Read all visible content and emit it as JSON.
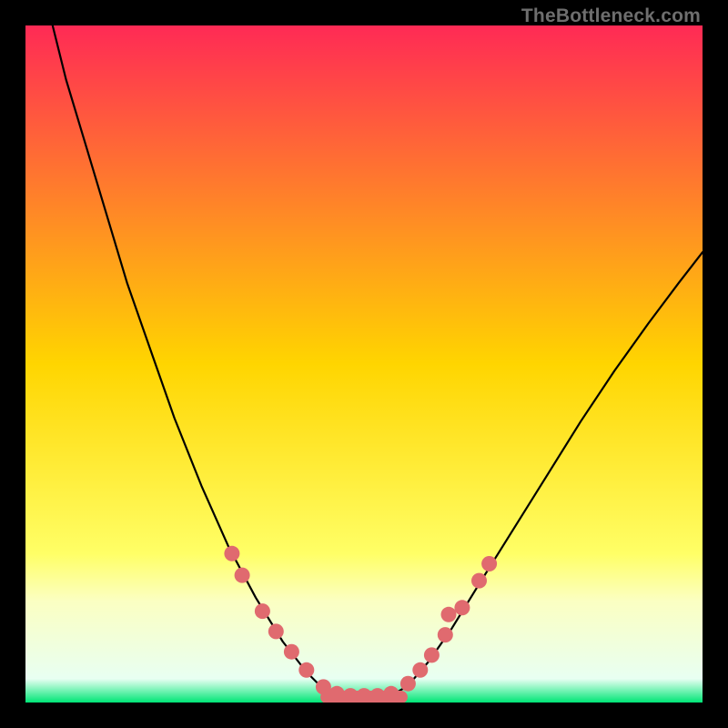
{
  "watermark": "TheBottleneck.com",
  "chart_data": {
    "type": "line",
    "title": "",
    "xlabel": "",
    "ylabel": "",
    "xlim": [
      0,
      100
    ],
    "ylim": [
      0,
      100
    ],
    "grid": false,
    "background_gradient": {
      "stops": [
        {
          "offset": 0.0,
          "color": "#ff2a55"
        },
        {
          "offset": 0.5,
          "color": "#ffd500"
        },
        {
          "offset": 0.78,
          "color": "#ffff66"
        },
        {
          "offset": 0.85,
          "color": "#fbffc2"
        },
        {
          "offset": 0.965,
          "color": "#e8fff2"
        },
        {
          "offset": 1.0,
          "color": "#00e676"
        }
      ]
    },
    "curve_left": {
      "name": "left-branch",
      "color": "#000000",
      "points": [
        {
          "x": 4.0,
          "y": 100.0
        },
        {
          "x": 6.0,
          "y": 92.0
        },
        {
          "x": 9.0,
          "y": 82.0
        },
        {
          "x": 12.0,
          "y": 72.0
        },
        {
          "x": 15.0,
          "y": 62.0
        },
        {
          "x": 18.5,
          "y": 52.0
        },
        {
          "x": 22.0,
          "y": 42.0
        },
        {
          "x": 26.0,
          "y": 32.0
        },
        {
          "x": 30.0,
          "y": 23.0
        },
        {
          "x": 34.0,
          "y": 15.5
        },
        {
          "x": 38.0,
          "y": 9.0
        },
        {
          "x": 41.5,
          "y": 4.5
        },
        {
          "x": 44.0,
          "y": 2.0
        },
        {
          "x": 46.0,
          "y": 1.0
        }
      ]
    },
    "curve_right": {
      "name": "right-branch",
      "color": "#000000",
      "points": [
        {
          "x": 54.0,
          "y": 1.0
        },
        {
          "x": 56.5,
          "y": 2.5
        },
        {
          "x": 59.5,
          "y": 6.0
        },
        {
          "x": 63.0,
          "y": 11.0
        },
        {
          "x": 67.0,
          "y": 17.5
        },
        {
          "x": 72.0,
          "y": 25.5
        },
        {
          "x": 77.0,
          "y": 33.5
        },
        {
          "x": 82.0,
          "y": 41.5
        },
        {
          "x": 87.0,
          "y": 49.0
        },
        {
          "x": 92.0,
          "y": 56.0
        },
        {
          "x": 96.5,
          "y": 62.0
        },
        {
          "x": 100.0,
          "y": 66.5
        }
      ]
    },
    "dots": {
      "color": "#e06a6f",
      "radius": 8.5,
      "points": [
        {
          "x": 30.5,
          "y": 22.0
        },
        {
          "x": 32.0,
          "y": 18.8
        },
        {
          "x": 35.0,
          "y": 13.5
        },
        {
          "x": 37.0,
          "y": 10.5
        },
        {
          "x": 39.3,
          "y": 7.5
        },
        {
          "x": 41.5,
          "y": 4.8
        },
        {
          "x": 44.0,
          "y": 2.3
        },
        {
          "x": 46.0,
          "y": 1.3
        },
        {
          "x": 48.0,
          "y": 1.0
        },
        {
          "x": 50.0,
          "y": 1.0
        },
        {
          "x": 52.0,
          "y": 1.0
        },
        {
          "x": 54.0,
          "y": 1.3
        },
        {
          "x": 56.5,
          "y": 2.8
        },
        {
          "x": 58.3,
          "y": 4.8
        },
        {
          "x": 60.0,
          "y": 7.0
        },
        {
          "x": 62.0,
          "y": 10.0
        },
        {
          "x": 62.5,
          "y": 13.0
        },
        {
          "x": 64.5,
          "y": 14.0
        },
        {
          "x": 67.0,
          "y": 18.0
        },
        {
          "x": 68.5,
          "y": 20.5
        }
      ]
    },
    "bottom_accent": {
      "color": "#e06a6f",
      "x_start": 44.5,
      "x_end": 55.5,
      "y": 0.8,
      "thickness_px": 14
    }
  }
}
